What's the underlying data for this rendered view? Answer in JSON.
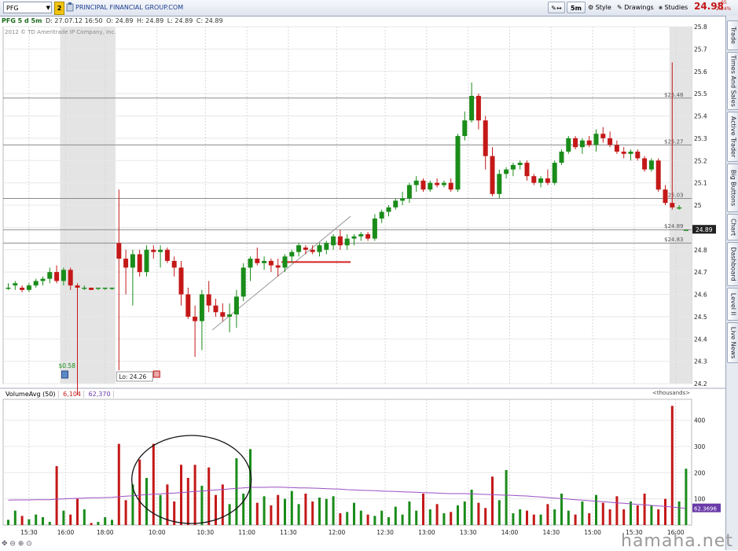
{
  "toolbar": {
    "symbol": "PFG",
    "link_badge": "2",
    "company_name": "PRINCIPAL FINANCIAL GROUP.COM",
    "timeframe_label": "5m",
    "style_label": "Style",
    "drawings_label": "Drawings",
    "studies_label": "Studies",
    "last_price": "24.98",
    "net_change": "-.65",
    "pct_change": "-2.54%"
  },
  "header": {
    "symbol_period": "PFG 5 d 5m",
    "date": "D: 27.07.12 16:50",
    "open": "O: 24.89",
    "high": "H: 24.89",
    "low": "L: 24.89",
    "close": "C: 24.89",
    "copyright": "2012 © TD Ameritrade IP Company, Inc."
  },
  "side_tabs": [
    "Trade",
    "Times And Sales",
    "Active Trader",
    "Big Buttons",
    "Chart",
    "Dashboard",
    "Level II",
    "Live News"
  ],
  "volume_header": {
    "study": "VolumeAvg (50)",
    "volume": "6,104",
    "avg": "62,370",
    "units": "<thousands>"
  },
  "watermark": "hamaha.net",
  "colors": {
    "up": "#1a8c1a",
    "down": "#c41818",
    "avg_line": "#9a4ec4",
    "session_shade": "#e4e4e4"
  },
  "chart_data": {
    "type": "candlestick",
    "symbol": "PFG",
    "interval": "5m",
    "price_axis": {
      "range": [
        24.2,
        25.8
      ],
      "ticks": [
        24.2,
        24.3,
        24.4,
        24.5,
        24.6,
        24.7,
        24.8,
        24.9,
        25,
        25.1,
        25.2,
        25.3,
        25.4,
        25.5,
        25.6,
        25.7,
        25.8
      ],
      "tick_labels": [
        "24.2",
        "24.3",
        "24.4",
        "24.5",
        "24.6",
        "24.7",
        "24.8",
        "24.9",
        "25",
        "25.1",
        "25.2",
        "25.3",
        "25.4",
        "25.5",
        "25.6",
        "25.7",
        "25.8"
      ],
      "last_price_marker": "24.89"
    },
    "time_axis": {
      "labels": [
        "15:30",
        "16:00",
        "18:00",
        "10:00",
        "10:30",
        "11:00",
        "11:30",
        "12:00",
        "12:30",
        "13:00",
        "13:30",
        "14:00",
        "14:30",
        "15:00",
        "15:30",
        "16:00"
      ]
    },
    "levels": [
      {
        "label": "$25.48",
        "value": 25.48
      },
      {
        "label": "$25.27",
        "value": 25.27
      },
      {
        "label": "$25.03",
        "value": 25.03
      },
      {
        "label": "$24.89",
        "value": 24.89
      },
      {
        "label": "$24.83",
        "value": 24.83
      }
    ],
    "annotations": [
      {
        "text": "Lo: 24.26",
        "value": 24.26
      },
      {
        "text": "$0.58",
        "kind": "dividend marker"
      }
    ],
    "candles": [
      {
        "o": 24.63,
        "h": 24.65,
        "l": 24.62,
        "c": 24.63
      },
      {
        "o": 24.64,
        "h": 24.66,
        "l": 24.62,
        "c": 24.65
      },
      {
        "o": 24.63,
        "h": 24.64,
        "l": 24.61,
        "c": 24.62
      },
      {
        "o": 24.62,
        "h": 24.65,
        "l": 24.61,
        "c": 24.64
      },
      {
        "o": 24.64,
        "h": 24.67,
        "l": 24.63,
        "c": 24.66
      },
      {
        "o": 24.66,
        "h": 24.68,
        "l": 24.64,
        "c": 24.67
      },
      {
        "o": 24.67,
        "h": 24.72,
        "l": 24.65,
        "c": 24.7
      },
      {
        "o": 24.7,
        "h": 24.73,
        "l": 24.65,
        "c": 24.66
      },
      {
        "o": 24.66,
        "h": 24.72,
        "l": 24.64,
        "c": 24.71
      },
      {
        "o": 24.71,
        "h": 24.72,
        "l": 24.62,
        "c": 24.64
      },
      {
        "o": 24.64,
        "h": 24.65,
        "l": 24.15,
        "c": 24.63
      },
      {
        "o": 24.63,
        "h": 24.64,
        "l": 24.62,
        "c": 24.63
      },
      {
        "o": 24.63,
        "h": 24.63,
        "l": 24.62,
        "c": 24.62
      },
      {
        "o": 24.63,
        "h": 24.63,
        "l": 24.62,
        "c": 24.63
      },
      {
        "o": 24.63,
        "h": 24.63,
        "l": 24.62,
        "c": 24.63
      },
      {
        "o": 24.63,
        "h": 24.63,
        "l": 24.62,
        "c": 24.63
      },
      {
        "o": 24.83,
        "h": 25.07,
        "l": 24.26,
        "c": 24.76
      },
      {
        "o": 24.76,
        "h": 24.8,
        "l": 24.6,
        "c": 24.72
      },
      {
        "o": 24.72,
        "h": 24.8,
        "l": 24.55,
        "c": 24.78
      },
      {
        "o": 24.78,
        "h": 24.8,
        "l": 24.68,
        "c": 24.7
      },
      {
        "o": 24.7,
        "h": 24.82,
        "l": 24.68,
        "c": 24.8
      },
      {
        "o": 24.8,
        "h": 24.82,
        "l": 24.76,
        "c": 24.79
      },
      {
        "o": 24.79,
        "h": 24.82,
        "l": 24.72,
        "c": 24.8
      },
      {
        "o": 24.8,
        "h": 24.81,
        "l": 24.74,
        "c": 24.75
      },
      {
        "o": 24.75,
        "h": 24.77,
        "l": 24.68,
        "c": 24.72
      },
      {
        "o": 24.72,
        "h": 24.75,
        "l": 24.55,
        "c": 24.6
      },
      {
        "o": 24.6,
        "h": 24.63,
        "l": 24.49,
        "c": 24.5
      },
      {
        "o": 24.5,
        "h": 24.55,
        "l": 24.32,
        "c": 24.48
      },
      {
        "o": 24.48,
        "h": 24.62,
        "l": 24.35,
        "c": 24.6
      },
      {
        "o": 24.6,
        "h": 24.66,
        "l": 24.52,
        "c": 24.55
      },
      {
        "o": 24.55,
        "h": 24.58,
        "l": 24.5,
        "c": 24.52
      },
      {
        "o": 24.52,
        "h": 24.56,
        "l": 24.48,
        "c": 24.5
      },
      {
        "o": 24.5,
        "h": 24.56,
        "l": 24.43,
        "c": 24.51
      },
      {
        "o": 24.51,
        "h": 24.62,
        "l": 24.45,
        "c": 24.59
      },
      {
        "o": 24.59,
        "h": 24.74,
        "l": 24.57,
        "c": 24.72
      },
      {
        "o": 24.72,
        "h": 24.77,
        "l": 24.66,
        "c": 24.76
      },
      {
        "o": 24.76,
        "h": 24.81,
        "l": 24.73,
        "c": 24.74
      },
      {
        "o": 24.74,
        "h": 24.77,
        "l": 24.71,
        "c": 24.75
      },
      {
        "o": 24.75,
        "h": 24.76,
        "l": 24.7,
        "c": 24.73
      },
      {
        "o": 24.73,
        "h": 24.76,
        "l": 24.68,
        "c": 24.72
      },
      {
        "o": 24.72,
        "h": 24.78,
        "l": 24.7,
        "c": 24.77
      },
      {
        "o": 24.77,
        "h": 24.8,
        "l": 24.74,
        "c": 24.79
      },
      {
        "o": 24.79,
        "h": 24.83,
        "l": 24.77,
        "c": 24.82
      },
      {
        "o": 24.81,
        "h": 24.82,
        "l": 24.78,
        "c": 24.8
      },
      {
        "o": 24.8,
        "h": 24.82,
        "l": 24.78,
        "c": 24.79
      },
      {
        "o": 24.79,
        "h": 24.83,
        "l": 24.77,
        "c": 24.82
      },
      {
        "o": 24.8,
        "h": 24.84,
        "l": 24.78,
        "c": 24.83
      },
      {
        "o": 24.82,
        "h": 24.87,
        "l": 24.8,
        "c": 24.86
      },
      {
        "o": 24.86,
        "h": 24.89,
        "l": 24.8,
        "c": 24.82
      },
      {
        "o": 24.82,
        "h": 24.87,
        "l": 24.8,
        "c": 24.85
      },
      {
        "o": 24.85,
        "h": 24.87,
        "l": 24.82,
        "c": 24.86
      },
      {
        "o": 24.86,
        "h": 24.88,
        "l": 24.84,
        "c": 24.87
      },
      {
        "o": 24.87,
        "h": 24.88,
        "l": 24.84,
        "c": 24.85
      },
      {
        "o": 24.85,
        "h": 24.96,
        "l": 24.84,
        "c": 24.94
      },
      {
        "o": 24.94,
        "h": 24.98,
        "l": 24.92,
        "c": 24.97
      },
      {
        "o": 24.97,
        "h": 25.0,
        "l": 24.95,
        "c": 24.99
      },
      {
        "o": 24.99,
        "h": 25.03,
        "l": 24.98,
        "c": 25.02
      },
      {
        "o": 25.02,
        "h": 25.06,
        "l": 25.0,
        "c": 25.03
      },
      {
        "o": 25.03,
        "h": 25.1,
        "l": 25.01,
        "c": 25.09
      },
      {
        "o": 25.09,
        "h": 25.13,
        "l": 25.06,
        "c": 25.11
      },
      {
        "o": 25.11,
        "h": 25.12,
        "l": 25.06,
        "c": 25.07
      },
      {
        "o": 25.07,
        "h": 25.11,
        "l": 25.06,
        "c": 25.1
      },
      {
        "o": 25.1,
        "h": 25.12,
        "l": 25.08,
        "c": 25.09
      },
      {
        "o": 25.09,
        "h": 25.11,
        "l": 25.08,
        "c": 25.1
      },
      {
        "o": 25.1,
        "h": 25.12,
        "l": 25.06,
        "c": 25.07
      },
      {
        "o": 25.07,
        "h": 25.32,
        "l": 25.06,
        "c": 25.31
      },
      {
        "o": 25.31,
        "h": 25.42,
        "l": 25.29,
        "c": 25.38
      },
      {
        "o": 25.38,
        "h": 25.55,
        "l": 25.37,
        "c": 25.49
      },
      {
        "o": 25.49,
        "h": 25.5,
        "l": 25.34,
        "c": 25.38
      },
      {
        "o": 25.38,
        "h": 25.4,
        "l": 25.16,
        "c": 25.22
      },
      {
        "o": 25.22,
        "h": 25.26,
        "l": 25.04,
        "c": 25.05
      },
      {
        "o": 25.05,
        "h": 25.16,
        "l": 25.03,
        "c": 25.14
      },
      {
        "o": 25.14,
        "h": 25.17,
        "l": 25.12,
        "c": 25.16
      },
      {
        "o": 25.16,
        "h": 25.19,
        "l": 25.13,
        "c": 25.18
      },
      {
        "o": 25.18,
        "h": 25.2,
        "l": 25.16,
        "c": 25.19
      },
      {
        "o": 25.19,
        "h": 25.2,
        "l": 25.11,
        "c": 25.13
      },
      {
        "o": 25.13,
        "h": 25.14,
        "l": 25.09,
        "c": 25.1
      },
      {
        "o": 25.1,
        "h": 25.13,
        "l": 25.08,
        "c": 25.12
      },
      {
        "o": 25.12,
        "h": 25.16,
        "l": 25.09,
        "c": 25.1
      },
      {
        "o": 25.1,
        "h": 25.2,
        "l": 25.09,
        "c": 25.19
      },
      {
        "o": 25.19,
        "h": 25.25,
        "l": 25.18,
        "c": 25.24
      },
      {
        "o": 25.24,
        "h": 25.31,
        "l": 25.23,
        "c": 25.3
      },
      {
        "o": 25.3,
        "h": 25.31,
        "l": 25.25,
        "c": 25.26
      },
      {
        "o": 25.26,
        "h": 25.3,
        "l": 25.23,
        "c": 25.29
      },
      {
        "o": 25.29,
        "h": 25.31,
        "l": 25.26,
        "c": 25.27
      },
      {
        "o": 25.27,
        "h": 25.34,
        "l": 25.24,
        "c": 25.32
      },
      {
        "o": 25.32,
        "h": 25.35,
        "l": 25.28,
        "c": 25.3
      },
      {
        "o": 25.3,
        "h": 25.33,
        "l": 25.26,
        "c": 25.27
      },
      {
        "o": 25.27,
        "h": 25.29,
        "l": 25.23,
        "c": 25.24
      },
      {
        "o": 25.24,
        "h": 25.26,
        "l": 25.21,
        "c": 25.23
      },
      {
        "o": 25.23,
        "h": 25.25,
        "l": 25.2,
        "c": 25.24
      },
      {
        "o": 25.24,
        "h": 25.25,
        "l": 25.2,
        "c": 25.21
      },
      {
        "o": 25.21,
        "h": 25.22,
        "l": 25.15,
        "c": 25.16
      },
      {
        "o": 25.16,
        "h": 25.21,
        "l": 25.15,
        "c": 25.2
      },
      {
        "o": 25.2,
        "h": 25.21,
        "l": 25.06,
        "c": 25.07
      },
      {
        "o": 25.07,
        "h": 25.09,
        "l": 25.0,
        "c": 25.01
      },
      {
        "o": 25.01,
        "h": 25.64,
        "l": 24.98,
        "c": 24.99
      },
      {
        "o": 24.99,
        "h": 25.0,
        "l": 24.98,
        "c": 24.99
      },
      {
        "o": 24.89,
        "h": 24.89,
        "l": 24.89,
        "c": 24.89
      }
    ],
    "volume_axis": {
      "range": [
        0,
        480
      ],
      "ticks": [
        100,
        200,
        300,
        400
      ],
      "tick_labels": [
        "100",
        "200",
        "300",
        "400"
      ],
      "units": "thousands",
      "avg_last_label": "62.3696"
    },
    "volume": [
      20,
      55,
      35,
      22,
      40,
      30,
      12,
      225,
      55,
      40,
      100,
      60,
      8,
      12,
      30,
      20,
      310,
      95,
      155,
      250,
      180,
      310,
      115,
      155,
      90,
      230,
      180,
      230,
      150,
      220,
      115,
      155,
      80,
      255,
      120,
      290,
      85,
      110,
      75,
      115,
      100,
      130,
      80,
      120,
      90,
      105,
      100,
      110,
      45,
      50,
      85,
      55,
      40,
      35,
      55,
      30,
      70,
      40,
      90,
      55,
      120,
      60,
      80,
      45,
      50,
      75,
      90,
      135,
      85,
      65,
      185,
      95,
      210,
      45,
      60,
      55,
      40,
      40,
      80,
      60,
      120,
      55,
      40,
      90,
      45,
      115,
      85,
      60,
      110,
      60,
      90,
      75,
      120,
      75,
      60,
      100,
      455,
      90,
      215
    ],
    "volume_avg": [
      95,
      96,
      96,
      96,
      97,
      97,
      97,
      99,
      100,
      101,
      102,
      103,
      104,
      104,
      105,
      106,
      108,
      110,
      112,
      114,
      116,
      118,
      119,
      121,
      122,
      124,
      126,
      128,
      130,
      132,
      134,
      136,
      138,
      140,
      142,
      144,
      144,
      144,
      145,
      145,
      144,
      143,
      142,
      142,
      141,
      140,
      139,
      138,
      137,
      135,
      134,
      133,
      132,
      131,
      130,
      129,
      128,
      127,
      126,
      125,
      124,
      123,
      122,
      121,
      120,
      120,
      120,
      119,
      118,
      117,
      116,
      115,
      114,
      113,
      112,
      111,
      109,
      107,
      105,
      103,
      101,
      99,
      97,
      95,
      93,
      91,
      89,
      87,
      85,
      83,
      81,
      79,
      77,
      75,
      73,
      71,
      69,
      66,
      64
    ],
    "volume_avg_scale_note": "values shown in thousands"
  }
}
